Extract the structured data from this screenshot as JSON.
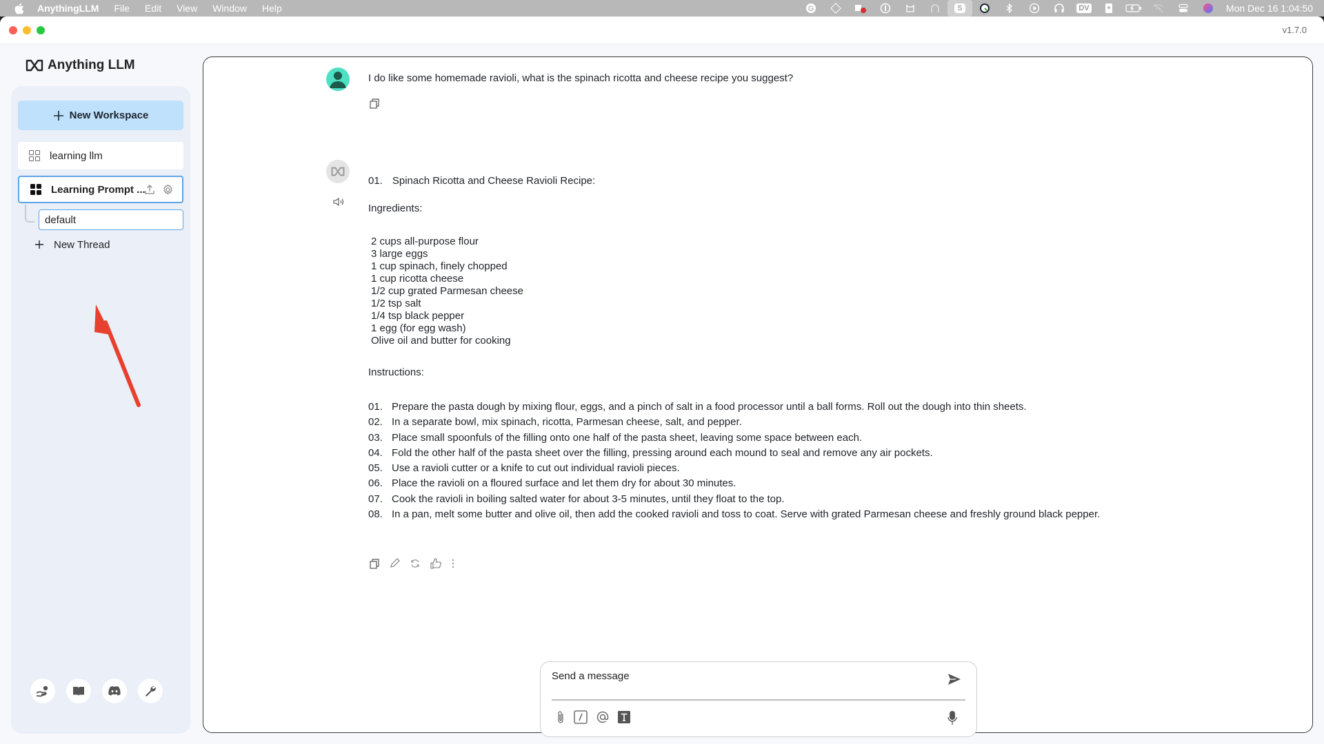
{
  "menubar": {
    "app_name": "AnythingLLM",
    "menus": [
      "File",
      "Edit",
      "View",
      "Window",
      "Help"
    ],
    "tray_icons": [
      "grammarly-icon",
      "drop-icon",
      "teams-icon",
      "onepassword-icon",
      "cat-download-icon",
      "arc-icon",
      "s-icon",
      "timer-icon",
      "bluetooth-icon",
      "play-icon",
      "headphones-icon",
      "dv-icon",
      "id-badge-icon",
      "battery-icon",
      "wifi-off-icon",
      "control-center-icon",
      "siri-icon"
    ],
    "dv_label": "DV",
    "s_label": "S",
    "clock": "Mon Dec 16  1:04:50"
  },
  "window": {
    "version": "v1.7.0"
  },
  "sidebar": {
    "logo_text": "Anything LLM",
    "new_workspace_label": "New Workspace",
    "workspaces": [
      {
        "label": "learning llm",
        "active": false
      },
      {
        "label": "Learning Prompt ...",
        "active": true
      }
    ],
    "threads": [
      {
        "label": "default",
        "active": true
      }
    ],
    "new_thread_label": "New Thread",
    "footer_icons": [
      "community-hub-icon",
      "docs-icon",
      "discord-icon",
      "settings-wrench-icon"
    ]
  },
  "chat": {
    "user_message": "I do like some homemade ravioli, what is the spinach ricotta and cheese recipe you suggest?",
    "bot": {
      "heading_num": "01.",
      "heading": "Spinach Ricotta and Cheese Ravioli Recipe:",
      "ingredients_label": "Ingredients:",
      "ingredients": [
        "2 cups all-purpose flour",
        "3 large eggs",
        "1 cup spinach, finely chopped",
        "1 cup ricotta cheese",
        "1/2 cup grated Parmesan cheese",
        "1/2 tsp salt",
        "1/4 tsp black pepper",
        "1 egg (for egg wash)",
        "Olive oil and butter for cooking"
      ],
      "instructions_label": "Instructions:",
      "steps": [
        {
          "n": "01.",
          "text": "Prepare the pasta dough by mixing flour, eggs, and a pinch of salt in a food processor until a ball forms. Roll out the dough into thin sheets."
        },
        {
          "n": "02.",
          "text": "In a separate bowl, mix spinach, ricotta, Parmesan cheese, salt, and pepper."
        },
        {
          "n": "03.",
          "text": "Place small spoonfuls of the filling onto one half of the pasta sheet, leaving some space between each."
        },
        {
          "n": "04.",
          "text": "Fold the other half of the pasta sheet over the filling, pressing around each mound to seal and remove any air pockets."
        },
        {
          "n": "05.",
          "text": "Use a ravioli cutter or a knife to cut out individual ravioli pieces."
        },
        {
          "n": "06.",
          "text": "Place the ravioli on a floured surface and let them dry for about 30 minutes."
        },
        {
          "n": "07.",
          "text": "Cook the ravioli in boiling salted water for about 3-5 minutes, until they float to the top."
        },
        {
          "n": "08.",
          "text": "In a pan, melt some butter and olive oil, then add the cooked ravioli and toss to coat. Serve with grated Parmesan cheese and freshly ground black pepper."
        }
      ]
    },
    "composer": {
      "placeholder": "Send a message",
      "value": ""
    }
  },
  "colors": {
    "accent_blue": "#bfe1fb",
    "active_border": "#5da4e6",
    "annotation_arrow": "#e8402e",
    "user_avatar": "#4ee0c3"
  }
}
